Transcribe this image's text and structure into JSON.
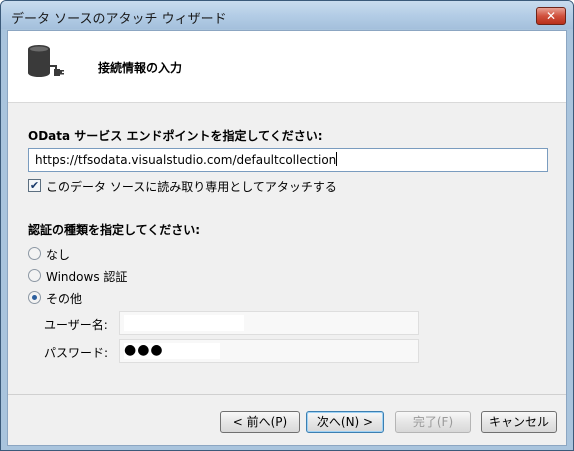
{
  "window": {
    "title": "データ ソースのアタッチ ウィザード",
    "close": "✕"
  },
  "header": {
    "icon": "database-connection-icon",
    "title": "接続情報の入力"
  },
  "endpoint": {
    "label": "OData サービス エンドポイントを指定してください:",
    "value": "https://tfsodata.visualstudio.com/defaultcollection"
  },
  "readonly": {
    "label": "このデータ ソースに読み取り専用としてアタッチする",
    "checked": true
  },
  "auth": {
    "label": "認証の種類を指定してください:",
    "options": [
      {
        "label": "なし",
        "selected": false
      },
      {
        "label": "Windows 認証",
        "selected": false
      },
      {
        "label": "その他",
        "selected": true
      }
    ]
  },
  "credentials": {
    "username_label": "ユーザー名:",
    "password_label": "パスワード:",
    "password_mask": "●●●"
  },
  "buttons": {
    "back": "< 前へ(P)",
    "next": "次へ(N) >",
    "finish": "完了(F)",
    "cancel": "キャンセル"
  }
}
